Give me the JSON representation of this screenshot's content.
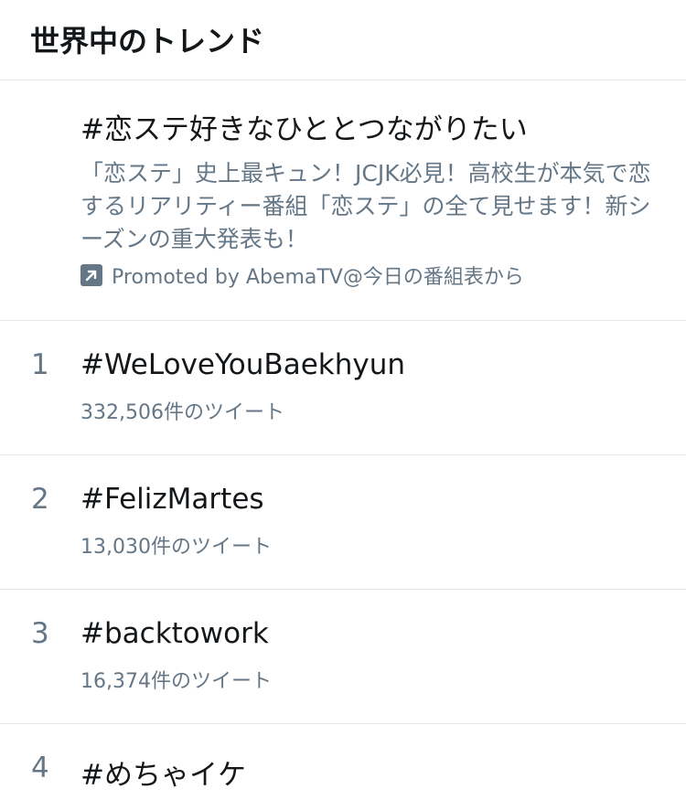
{
  "header": {
    "title": "世界中のトレンド"
  },
  "promoted": {
    "hashtag": "#恋ステ好きなひととつながりたい",
    "description": "「恋ステ」史上最キュン！JCJK必見！高校生が本気で恋するリアリティー番組「恋ステ」の全て見せます！新シーズンの重大発表も！",
    "promoted_by": "Promoted by AbemaTV@今日の番組表から",
    "icon": "promoted-arrow-icon"
  },
  "trends": [
    {
      "rank": "1",
      "name": "#WeLoveYouBaekhyun",
      "count": "332,506件のツイート"
    },
    {
      "rank": "2",
      "name": "#FelizMartes",
      "count": "13,030件のツイート"
    },
    {
      "rank": "3",
      "name": "#backtowork",
      "count": "16,374件のツイート"
    },
    {
      "rank": "4",
      "name": "#めちゃイケ",
      "count": ""
    }
  ],
  "colors": {
    "primary_text": "#14171a",
    "secondary_text": "#657786",
    "divider": "#e1e8ed"
  }
}
